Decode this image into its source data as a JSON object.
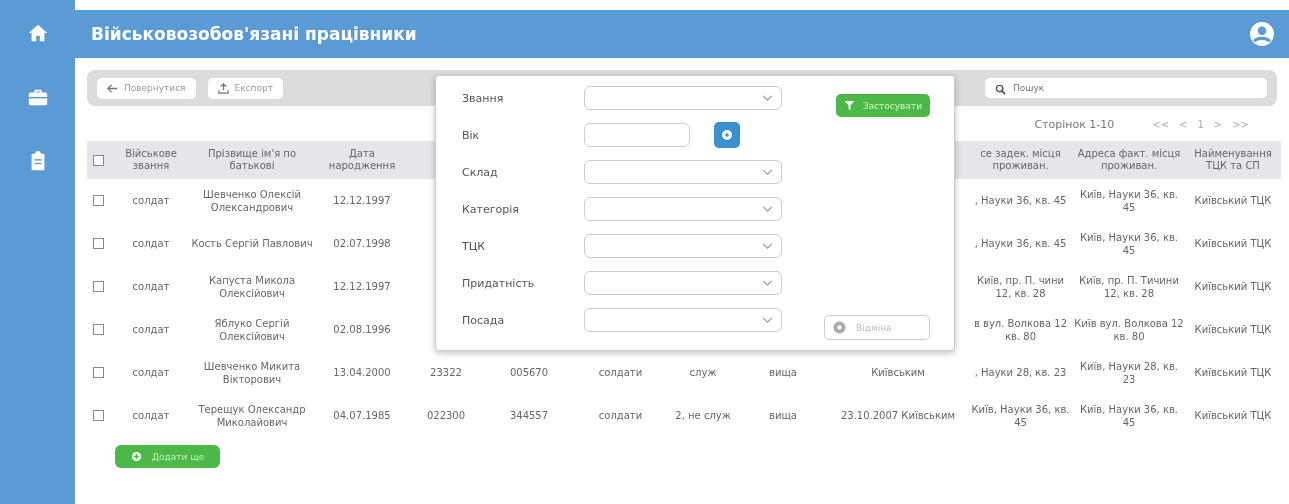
{
  "header": {
    "title": "Військовозобов'язані працівники"
  },
  "toolbar": {
    "buttons": [
      {
        "label": "Повернутися",
        "kind": "back"
      },
      {
        "label": "Експорт",
        "kind": "export"
      }
    ],
    "search": {
      "placeholder": "Пошук"
    }
  },
  "pagination": {
    "summary": "Сторінок 1-10",
    "controls": [
      "<<",
      "<",
      "1",
      ">",
      ">>"
    ]
  },
  "table": {
    "all_checked": false,
    "columns": [
      "Військове звання",
      "Прізвище ім'я по батькові",
      "Дата народження",
      null,
      null,
      null,
      null,
      null,
      null,
      "се задек. місця проживан.",
      "Адреса факт. місця проживан.",
      "Найменування ТЦК та СП"
    ],
    "rows": [
      {
        "checked": false,
        "cells": [
          "солдат",
          "Шевченко Олексій Олександрович",
          "12.12.1997",
          null,
          null,
          null,
          null,
          null,
          null,
          ", Науки 36, кв. 45",
          "Київ, Науки 36, кв. 45",
          "Київський ТЦК"
        ]
      },
      {
        "checked": false,
        "cells": [
          "солдат",
          "Кость Сергій Павлович",
          "02.07.1998",
          null,
          null,
          null,
          null,
          null,
          null,
          ", Науки 36, кв. 45",
          "Київ, Науки 36, кв. 45",
          "Київський ТЦК"
        ]
      },
      {
        "checked": false,
        "cells": [
          "солдат",
          "Капуста Микола Олексійович",
          "12.12.1997",
          null,
          null,
          null,
          null,
          null,
          null,
          "Київ, пр. П. чини 12, кв. 28",
          "Київ, пр. П. Тичини 12, кв. 28",
          "Київський ТЦК"
        ]
      },
      {
        "checked": false,
        "cells": [
          "солдат",
          "Яблуко Сергій Олексійович",
          "02.08.1996",
          null,
          null,
          null,
          null,
          null,
          null,
          "в вул. Волкова 12 кв. 80",
          "Київ вул. Волкова 12 кв. 80",
          "Київський ТЦК"
        ]
      },
      {
        "checked": false,
        "cells": [
          "солдат",
          "Шевченко Микита Вікторович",
          "13.04.2000",
          "23322",
          "005670",
          "солдати",
          "служ",
          "вища",
          "Київським",
          ", Науки 28, кв. 23",
          "Київ, Науки 28, кв. 23",
          "Київський ТЦК"
        ]
      },
      {
        "checked": false,
        "cells": [
          "солдат",
          "Терещук Олександр Миколайович",
          "04.07.1985",
          "022300",
          "344557",
          "солдати",
          "2, не служ",
          "вища",
          "23.10.2007 Київським",
          "Київ, Науки 36, кв. 45",
          "Київ, Науки 36, кв. 45",
          "Київський ТЦК"
        ]
      }
    ]
  },
  "add_button": {
    "label": "Додати ще"
  },
  "filter_panel": {
    "fields": [
      {
        "label": "Звання",
        "kind": "select"
      },
      {
        "label": "Вік",
        "kind": "input"
      },
      {
        "label": "Склад",
        "kind": "select"
      },
      {
        "label": "Категорія",
        "kind": "select"
      },
      {
        "label": "ТЦК",
        "kind": "select"
      },
      {
        "label": "Придатність",
        "kind": "select"
      },
      {
        "label": "Посада",
        "kind": "select"
      }
    ],
    "apply_button": "Застосувати",
    "cancel_button": "Відміна"
  }
}
